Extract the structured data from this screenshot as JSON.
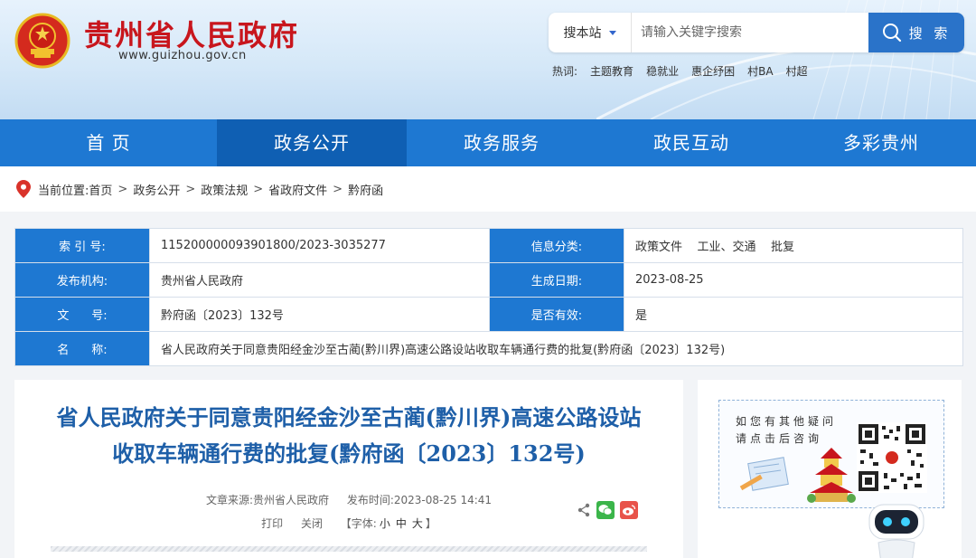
{
  "header": {
    "site_title": "贵州省人民政府",
    "site_url": "www.guizhou.gov.cn",
    "search_scope": "搜本站",
    "search_placeholder": "请输入关键字搜索",
    "search_button": "搜 索",
    "hot_label": "热词:",
    "hot_words": [
      "主题教育",
      "稳就业",
      "惠企纾困",
      "村BA",
      "村超"
    ]
  },
  "nav": [
    "首 页",
    "政务公开",
    "政务服务",
    "政民互动",
    "多彩贵州"
  ],
  "breadcrumb": {
    "label": "当前位置:",
    "items": [
      "首页",
      "政务公开",
      "政策法规",
      "省政府文件",
      "黔府函"
    ]
  },
  "info": {
    "index_key": "索 引 号:",
    "index_val": "115200000093901800/2023-3035277",
    "category_key": "信息分类:",
    "category_val": "政策文件    工业、交通    批复",
    "publisher_key": "发布机构:",
    "publisher_val": "贵州省人民政府",
    "date_key": "生成日期:",
    "date_val": "2023-08-25",
    "docno_key": "文      号:",
    "docno_val": "黔府函〔2023〕132号",
    "valid_key": "是否有效:",
    "valid_val": "是",
    "name_key": "名      称:",
    "name_val": "省人民政府关于同意贵阳经金沙至古蔺(黔川界)高速公路设站收取车辆通行费的批复(黔府函〔2023〕132号)"
  },
  "article": {
    "title": "省人民政府关于同意贵阳经金沙至古蔺(黔川界)高速公路设站收取车辆通行费的批复(黔府函〔2023〕132号)",
    "source": "文章来源:贵州省人民政府",
    "time": "发布时间:2023-08-25 14:41",
    "print": "打印",
    "close": "关闭",
    "font_prefix": "【字体:",
    "font_small": "小",
    "font_medium": "中",
    "font_large": "大",
    "font_suffix": "】"
  },
  "side": {
    "question_line1": "如您有其他疑问",
    "question_line2": "请点击后咨询"
  },
  "colors": {
    "brand_red": "#c8161d",
    "nav_blue": "#1e78d2",
    "nav_active": "#0f5fb3",
    "title_blue": "#1e5fa8"
  }
}
